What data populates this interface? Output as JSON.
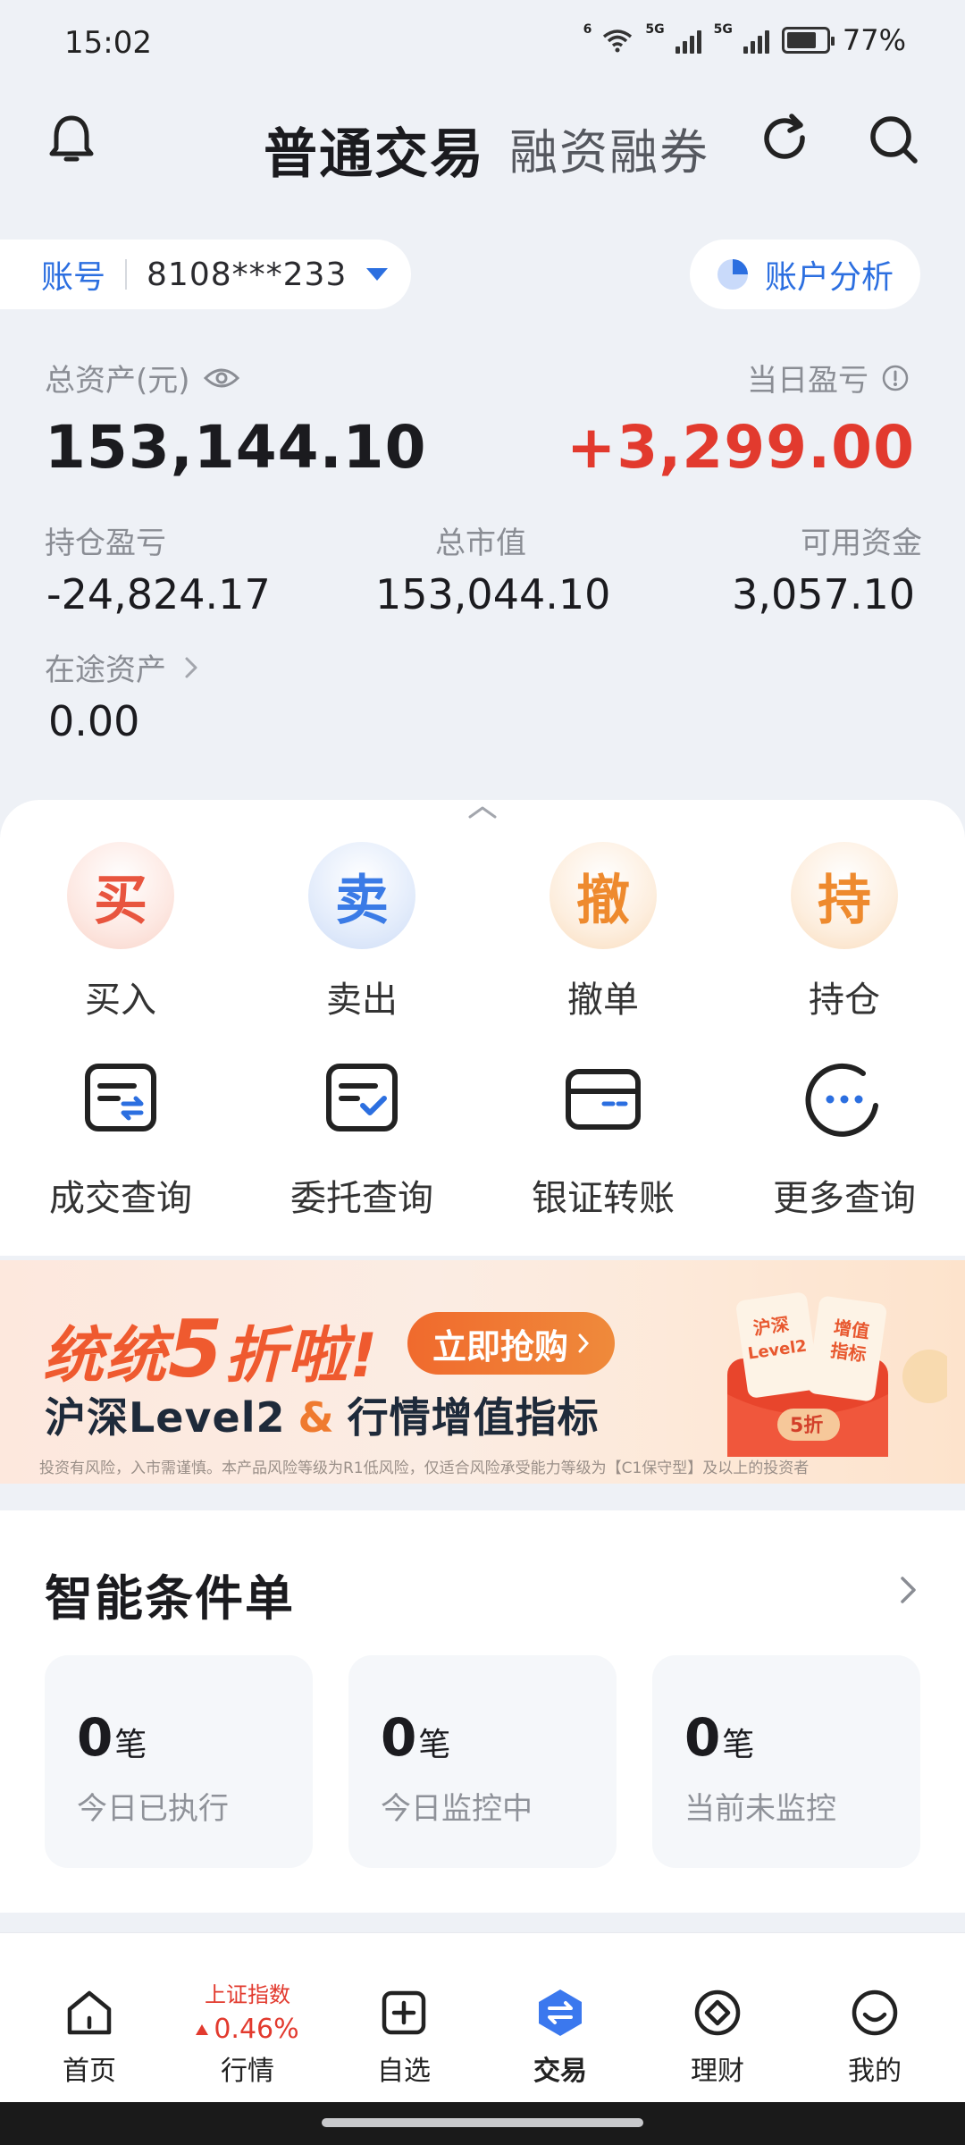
{
  "status_bar": {
    "time": "15:02",
    "net1": "6",
    "net2": "5G",
    "net3": "5G",
    "battery": "77%"
  },
  "header": {
    "tab_active": "普通交易",
    "tab_other": "融资融券"
  },
  "account": {
    "label": "账号",
    "number": "8108***233",
    "analysis_label": "账户分析"
  },
  "assets": {
    "total_label": "总资产(元)",
    "total_value": "153,144.10",
    "daily_pnl_label": "当日盈亏",
    "daily_pnl_value": "+3,299.00",
    "holding_pnl_label": "持仓盈亏",
    "holding_pnl_value": "-24,824.17",
    "market_value_label": "总市值",
    "market_value_value": "153,044.10",
    "available_label": "可用资金",
    "available_value": "3,057.10",
    "transit_label": "在途资产",
    "transit_value": "0.00"
  },
  "actions": [
    {
      "glyph": "买",
      "label": "买入"
    },
    {
      "glyph": "卖",
      "label": "卖出"
    },
    {
      "glyph": "撤",
      "label": "撤单"
    },
    {
      "glyph": "持",
      "label": "持仓"
    }
  ],
  "queries": [
    {
      "label": "成交查询",
      "icon": "deal-query-icon"
    },
    {
      "label": "委托查询",
      "icon": "order-query-icon"
    },
    {
      "label": "银证转账",
      "icon": "bank-transfer-icon"
    },
    {
      "label": "更多查询",
      "icon": "more-query-icon"
    }
  ],
  "banner": {
    "title_a": "统统",
    "title_b": "5",
    "title_c": "折啦!",
    "cta": "立即抢购",
    "sub_a": "沪深Level2",
    "sub_amp": "&",
    "sub_b": "行情增值指标",
    "disclaimer": "投资有风险，入市需谨慎。本产品风险等级为R1低风险，仅适合风险承受能力等级为【C1保守型】及以上的投资者",
    "card_text_a": "沪深",
    "card_text_b": "Level2",
    "card_text_c": "增值",
    "card_text_d": "指标",
    "card_text_e": "5折"
  },
  "smart_orders": {
    "title": "智能条件单",
    "stats": [
      {
        "count": "0",
        "unit": "笔",
        "desc": "今日已执行"
      },
      {
        "count": "0",
        "unit": "笔",
        "desc": "今日监控中"
      },
      {
        "count": "0",
        "unit": "笔",
        "desc": "当前未监控"
      }
    ]
  },
  "tabbar": {
    "home": "首页",
    "market_index": "上证指数",
    "market_change": "0.46%",
    "market": "行情",
    "watchlist": "自选",
    "trade": "交易",
    "wealth": "理财",
    "me": "我的"
  },
  "colors": {
    "accent": "#2c6fe0",
    "up": "#e23a2e",
    "banner_orange": "#ef5a2f"
  }
}
